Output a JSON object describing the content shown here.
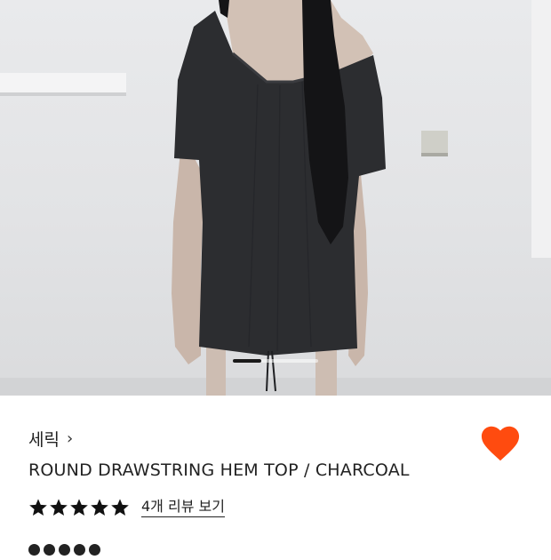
{
  "product": {
    "brand": "세릭",
    "name": "ROUND DRAWSTRING HEM TOP / CHARCOAL",
    "rating": 5,
    "rating_max": 5,
    "review_link": "4개 리뷰 보기",
    "wishlisted": true
  },
  "gallery": {
    "active_index": 1,
    "image_count": 3
  },
  "colors": {
    "heart": "#FF4B0F",
    "star": "#111111",
    "garment": "#2c2d30"
  }
}
